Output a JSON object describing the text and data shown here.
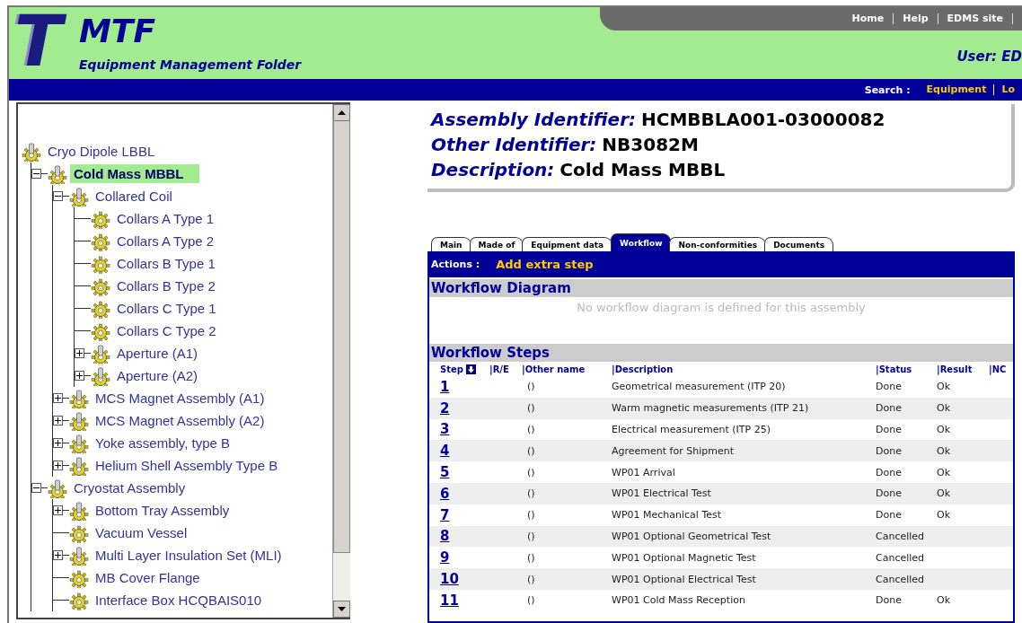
{
  "header": {
    "logo_letter": "T",
    "title": "MTF",
    "subtitle": "Equipment Management Folder",
    "nav_links": [
      "Home",
      "Help",
      "EDMS site"
    ],
    "user": "User: ED",
    "search_label": "Search :",
    "search_links": [
      "Equipment",
      "Lo"
    ]
  },
  "tree": [
    {
      "label": "Cryo Dipole LBBL",
      "kind": "assembly",
      "selected": false,
      "children": [
        {
          "label": "Cold Mass MBBL",
          "kind": "assembly",
          "selected": true,
          "expanded": true,
          "children": [
            {
              "label": "Collared Coil",
              "kind": "assembly",
              "selected": false,
              "expanded": true,
              "children": [
                {
                  "label": "Collars A Type 1",
                  "kind": "part",
                  "selected": false
                },
                {
                  "label": "Collars A Type 2",
                  "kind": "part",
                  "selected": false
                },
                {
                  "label": "Collars B Type 1",
                  "kind": "part",
                  "selected": false
                },
                {
                  "label": "Collars B Type 2",
                  "kind": "part",
                  "selected": false
                },
                {
                  "label": "Collars C Type 1",
                  "kind": "part",
                  "selected": false
                },
                {
                  "label": "Collars C Type 2",
                  "kind": "part",
                  "selected": false
                },
                {
                  "label": "Aperture (A1)",
                  "kind": "assembly",
                  "selected": false,
                  "expanded": false
                },
                {
                  "label": "Aperture (A2)",
                  "kind": "assembly",
                  "selected": false,
                  "expanded": false
                }
              ]
            },
            {
              "label": "MCS Magnet Assembly (A1)",
              "kind": "assembly",
              "selected": false,
              "expanded": false
            },
            {
              "label": "MCS Magnet Assembly (A2)",
              "kind": "assembly",
              "selected": false,
              "expanded": false
            },
            {
              "label": "Yoke assembly, type B",
              "kind": "assembly",
              "selected": false,
              "expanded": false
            },
            {
              "label": "Helium Shell Assembly Type B",
              "kind": "assembly",
              "selected": false,
              "expanded": false
            }
          ]
        },
        {
          "label": "Cryostat Assembly",
          "kind": "assembly",
          "selected": false,
          "expanded": true,
          "children": [
            {
              "label": "Bottom Tray Assembly",
              "kind": "assembly",
              "selected": false,
              "expanded": false
            },
            {
              "label": "Vacuum Vessel",
              "kind": "part",
              "selected": false
            },
            {
              "label": "Multi Layer Insulation Set (MLI)",
              "kind": "assembly",
              "selected": false,
              "expanded": false
            },
            {
              "label": "MB Cover Flange",
              "kind": "part",
              "selected": false
            },
            {
              "label": "Interface Box HCQBAIS010",
              "kind": "part",
              "selected": false
            }
          ]
        }
      ]
    }
  ],
  "identifiers": [
    {
      "label": "Assembly Identifier:",
      "value": "HCMBBLA001-03000082"
    },
    {
      "label": "Other Identifier:",
      "value": "NB3082M"
    },
    {
      "label": "Description:",
      "value": "Cold Mass MBBL"
    }
  ],
  "tabs": [
    {
      "label": "Main",
      "selected": false
    },
    {
      "label": "Made of",
      "selected": false
    },
    {
      "label": "Equipment data",
      "selected": false
    },
    {
      "label": "Workflow",
      "selected": true
    },
    {
      "label": "Non-conformities",
      "selected": false
    },
    {
      "label": "Documents",
      "selected": false
    }
  ],
  "actions": {
    "label": "Actions :",
    "links": [
      "Add extra step"
    ]
  },
  "workflow_diagram": {
    "title": "Workflow Diagram",
    "message": "No workflow diagram is defined for this assembly"
  },
  "workflow_steps": {
    "title": "Workflow Steps",
    "columns": [
      "Step",
      "|R/E",
      "|Other name",
      "|Description",
      "|Status",
      "|Result",
      "|NC"
    ],
    "rows": [
      {
        "step": "1",
        "other_name": "()",
        "description": "Geometrical measurement (ITP 20)",
        "status": "Done",
        "result": "Ok"
      },
      {
        "step": "2",
        "other_name": "()",
        "description": "Warm magnetic measurements (ITP 21)",
        "status": "Done",
        "result": "Ok"
      },
      {
        "step": "3",
        "other_name": "()",
        "description": "Electrical measurement (ITP 25)",
        "status": "Done",
        "result": "Ok"
      },
      {
        "step": "4",
        "other_name": "()",
        "description": "Agreement for Shipment",
        "status": "Done",
        "result": "Ok"
      },
      {
        "step": "5",
        "other_name": "()",
        "description": "WP01 Arrival",
        "status": "Done",
        "result": "Ok"
      },
      {
        "step": "6",
        "other_name": "()",
        "description": "WP01 Electrical Test",
        "status": "Done",
        "result": "Ok"
      },
      {
        "step": "7",
        "other_name": "()",
        "description": "WP01 Mechanical Test",
        "status": "Done",
        "result": "Ok"
      },
      {
        "step": "8",
        "other_name": "()",
        "description": "WP01 Optional Geometrical Test",
        "status": "Cancelled"
      },
      {
        "step": "9",
        "other_name": "()",
        "description": "WP01 Optional Magnetic Test",
        "status": "Cancelled"
      },
      {
        "step": "10",
        "other_name": "()",
        "description": "WP01 Optional Electrical Test",
        "status": "Cancelled"
      },
      {
        "step": "11",
        "other_name": "()",
        "description": "WP01 Cold Mass Reception",
        "status": "Done",
        "result": "Ok"
      }
    ]
  }
}
